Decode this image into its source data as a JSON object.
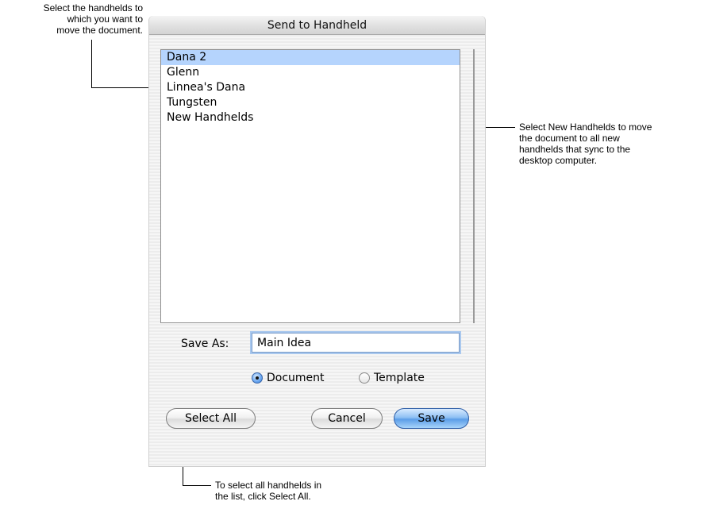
{
  "dialog": {
    "title": "Send to Handheld",
    "handhelds": [
      "Dana 2",
      "Glenn",
      "Linnea's Dana",
      "Tungsten",
      "New Handhelds"
    ],
    "selected_handheld": "Dana 2",
    "save_as_label": "Save As:",
    "save_as_value": "Main Idea",
    "radio_document_label": "Document",
    "radio_template_label": "Template",
    "selected_type": "Document",
    "select_all_label": "Select All",
    "cancel_label": "Cancel",
    "save_label": "Save",
    "colors": {
      "selection": "#b5d4fd",
      "default_button": "#5c9de7"
    }
  },
  "callouts": {
    "list_callout": [
      "Select the handhelds to",
      "which you want to",
      "move the document."
    ],
    "new_handhelds_callout": [
      "Select New Handhelds to move",
      "the document to all new",
      "handhelds that sync to the",
      "desktop computer."
    ],
    "select_all_callout": [
      "To select all handhelds in",
      "the list, click Select All."
    ]
  }
}
